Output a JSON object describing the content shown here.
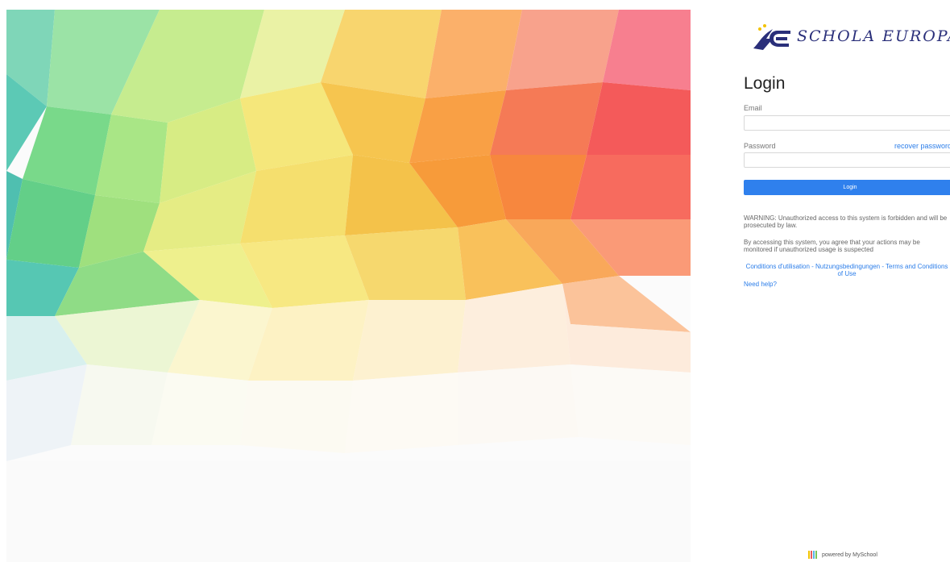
{
  "logo": {
    "text": "SCHOLA EUROPAEA",
    "icon": "schola-europaea-logo"
  },
  "login": {
    "title": "Login",
    "email_label": "Email",
    "email_value": "",
    "password_label": "Password",
    "password_value": "",
    "recover_label": "recover password",
    "button_label": "Login"
  },
  "notices": {
    "warning": "WARNING: Unauthorized access to this system is forbidden and will be prosecuted by law.",
    "monitor": "By accessing this system, you agree that your actions may be monitored if unauthorized usage is suspected",
    "terms": "Conditions d'utilisation - Nutzungsbedingungen - Terms and Conditions of Use",
    "help": "Need help?"
  },
  "footer": {
    "powered_by": "powered by MySchool",
    "icon": "myschool-logo-icon"
  },
  "colors": {
    "accent": "#2f80ed",
    "link": "#2b7de9",
    "logo": "#2a2f7a"
  }
}
